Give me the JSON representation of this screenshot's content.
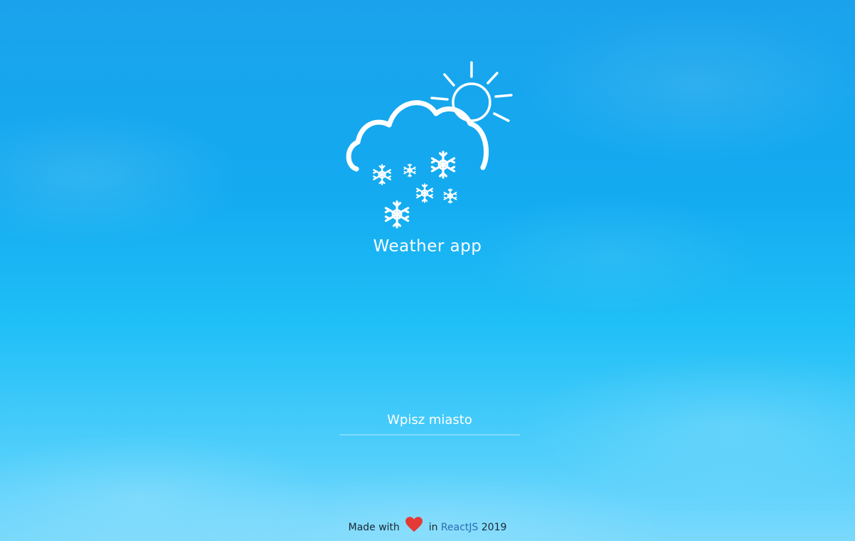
{
  "app": {
    "title": "Weather app"
  },
  "search": {
    "placeholder": "Wpisz miasto",
    "value": ""
  },
  "footer": {
    "made_with": "Made with",
    "in": "in",
    "link_label": "ReactJS",
    "year": "2019"
  },
  "icons": {
    "logo": "cloud-sun-snow-icon",
    "heart": "heart-icon"
  },
  "colors": {
    "background_top": "#1aa3ec",
    "background_bottom": "#7ad9fc",
    "text": "#ffffff",
    "heart": "#e53935",
    "link": "#2a6cb3"
  }
}
